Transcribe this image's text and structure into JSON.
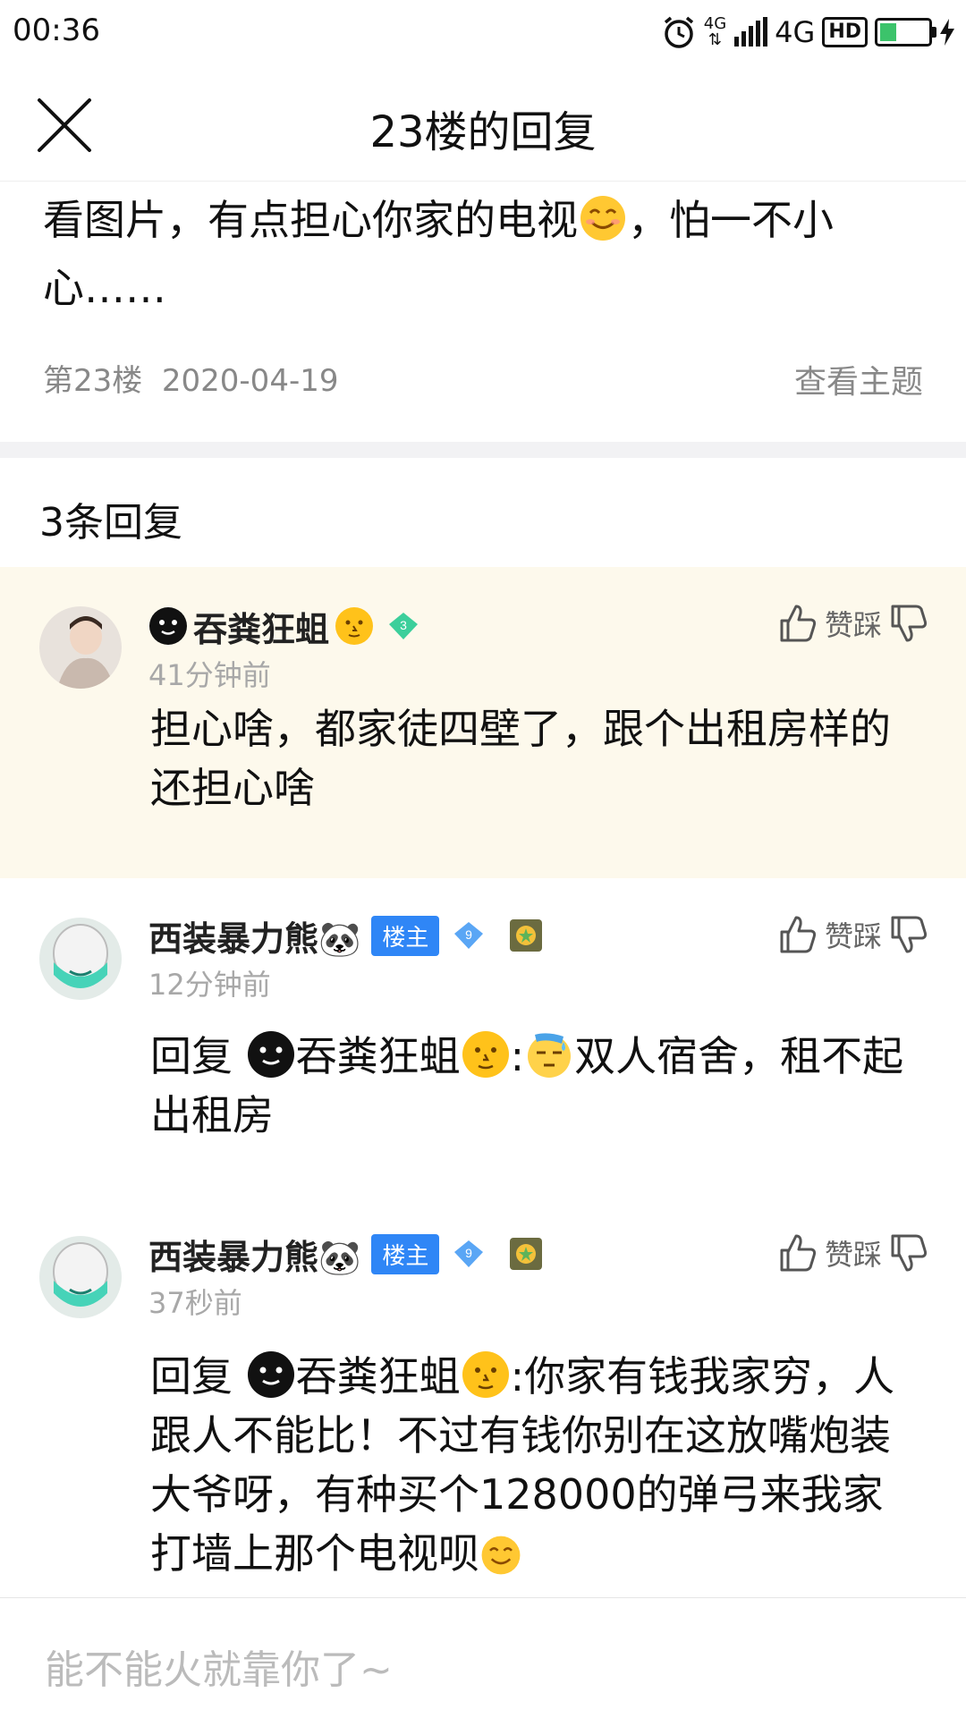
{
  "status": {
    "time": "00:36",
    "net_small_top": "4G",
    "net_small_bottom": "⇅",
    "network": "4G",
    "hd": "HD",
    "battery_level": 0.35
  },
  "header": {
    "title": "23楼的回复"
  },
  "original": {
    "text_before": "看图片，有点担心你家的电视",
    "text_after": "，怕一不小心……",
    "floor": "第23楼",
    "date": "2020-04-19",
    "view_topic": "查看主题"
  },
  "reply_count": "3条回复",
  "vote_label": "赞踩",
  "replies": [
    {
      "user": "吞粪狂蛆",
      "level": "3",
      "time": "41分钟前",
      "text": "担心啥，都家徒四壁了，跟个出租房样的还担心啥"
    },
    {
      "user": "西装暴力熊🐼",
      "badge": "楼主",
      "level": "9",
      "time": "12分钟前",
      "reply_prefix": "回复 ",
      "mention": "吞粪狂蛆",
      "text": "双人宿舍，租不起出租房"
    },
    {
      "user": "西装暴力熊🐼",
      "badge": "楼主",
      "level": "9",
      "time": "37秒前",
      "reply_prefix": "回复 ",
      "mention": "吞粪狂蛆",
      "text": ":你家有钱我家穷，人跟人不能比！不过有钱你别在这放嘴炮装大爷呀，有种买个128000的弹弓来我家打墙上那个电视呗"
    }
  ],
  "input": {
    "placeholder": "能不能火就靠你了~"
  },
  "colors": {
    "highlight": "#fdf9ec",
    "owner_badge": "#2f86f6",
    "level_diamond_green": "#3ccf9b",
    "level_diamond_blue": "#5aa6f5"
  },
  "icons": [
    "close-icon",
    "thumb-up-icon",
    "thumb-down-icon",
    "smile-emoji-icon",
    "black-face-emoji-icon",
    "moon-face-emoji-icon",
    "sweat-emoji-icon",
    "level-diamond-icon",
    "medal-icon",
    "alarm-icon",
    "signal-icon",
    "battery-icon"
  ]
}
